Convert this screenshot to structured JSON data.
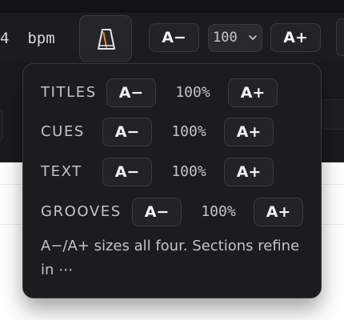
{
  "toolbar": {
    "bpm_text": "4  bpm",
    "metronome_icon": "metronome-icon",
    "decrease_label": "A−",
    "zoom_value": "100",
    "zoom_chevron_icon": "chevron-down-icon",
    "increase_label": "A+"
  },
  "popover": {
    "rows": [
      {
        "label": "TITLES",
        "decrease": "A−",
        "percent": "100%",
        "increase": "A+"
      },
      {
        "label": "CUES",
        "decrease": "A−",
        "percent": "100%",
        "increase": "A+"
      },
      {
        "label": "TEXT",
        "decrease": "A−",
        "percent": "100%",
        "increase": "A+"
      },
      {
        "label": "GROOVES",
        "decrease": "A−",
        "percent": "100%",
        "increase": "A+"
      }
    ],
    "note": "A−/A+ sizes all four. Sections refine in ⋯"
  },
  "colors": {
    "toolbar_bg": "#1c1c1f",
    "popover_bg": "#1c1c1f",
    "button_bg": "#232327",
    "text_primary": "#f2f2f5",
    "text_secondary": "#c4c4c8",
    "page_bg": "#ffffff"
  }
}
